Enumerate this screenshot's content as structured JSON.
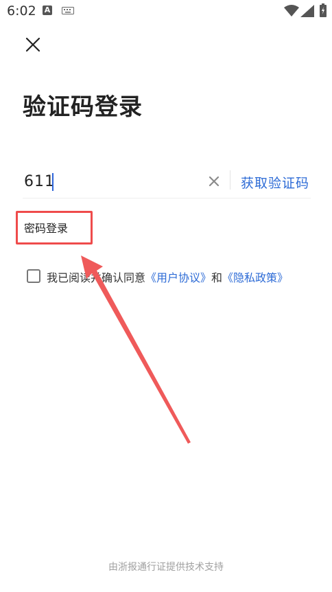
{
  "status_bar": {
    "time": "6:02",
    "a_label": "A",
    "icons": [
      "a-notification-icon",
      "keyboard-icon",
      "wifi-icon",
      "signal-icon",
      "battery-icon"
    ]
  },
  "header": {
    "close_icon": "close-icon",
    "title": "验证码登录"
  },
  "form": {
    "phone_value": "611",
    "get_code_label": "获取验证码",
    "password_login_label": "密码登录"
  },
  "agreement": {
    "prefix": "我已阅读并确认同意",
    "user_agreement": "《用户协议》",
    "and": "和",
    "privacy_policy": "《隐私政策》"
  },
  "footer": {
    "text": "由浙报通行证提供技术支持"
  },
  "colors": {
    "accent": "#2d6bd6",
    "annotation": "#ef4b4b",
    "text": "#222222",
    "muted": "#a0a0a0"
  }
}
